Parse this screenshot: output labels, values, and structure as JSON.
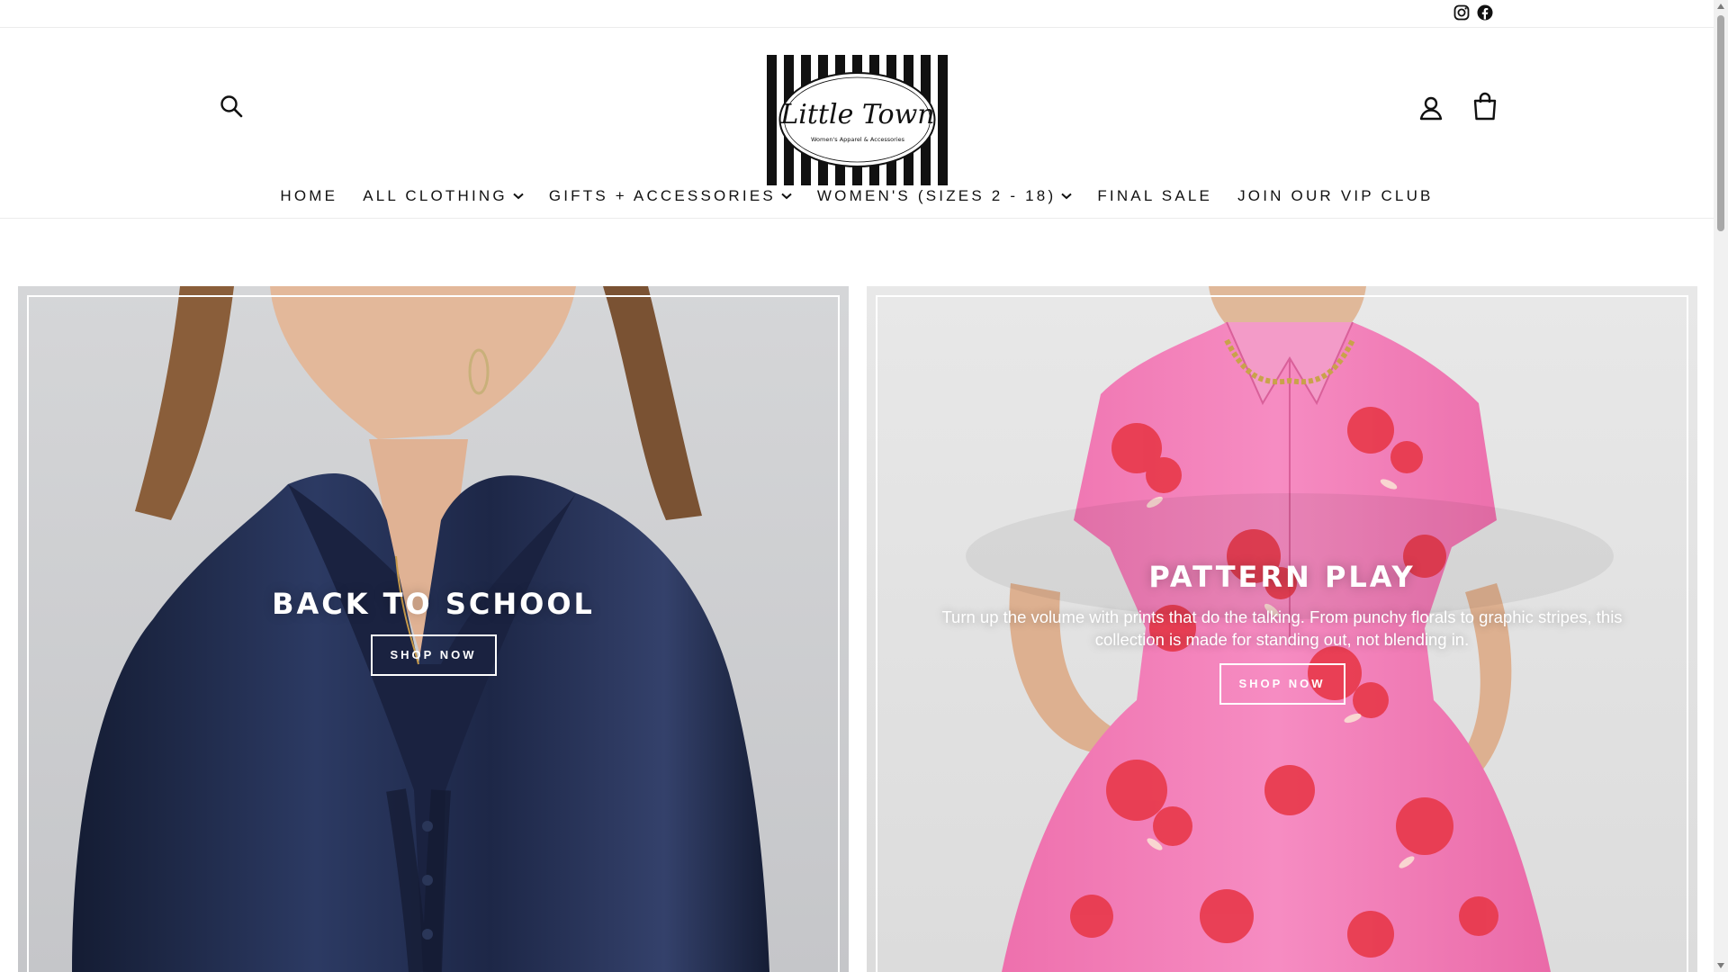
{
  "topbar": {
    "social_icons": [
      "instagram-icon",
      "facebook-icon"
    ]
  },
  "header": {
    "logo_text": "Little Town",
    "logo_tagline": "Women's Apparel & Accessories",
    "icons": {
      "search": "search-icon",
      "account": "user-icon",
      "cart": "shopping-bag-icon"
    },
    "search_label": "Search",
    "account_label": "Log in",
    "cart_label": "Cart"
  },
  "nav": {
    "items": [
      {
        "label": "HOME",
        "dropdown": false
      },
      {
        "label": "ALL CLOTHING",
        "dropdown": true
      },
      {
        "label": "GIFTS + ACCESSORIES",
        "dropdown": true
      },
      {
        "label": "WOMEN'S (SIZES 2 - 18)",
        "dropdown": true
      },
      {
        "label": "FINAL SALE",
        "dropdown": false
      },
      {
        "label": "JOIN OUR VIP CLUB",
        "dropdown": false
      }
    ]
  },
  "panels": [
    {
      "title": "BACK TO SCHOOL",
      "description": "",
      "button": "SHOP NOW"
    },
    {
      "title": "PATTERN PLAY",
      "description": "Turn up the volume with prints that do the talking. From punchy florals to graphic stripes, this collection is made for standing out, not blending in.",
      "button": "SHOP NOW"
    }
  ],
  "colors": {
    "text": "#111111",
    "border": "#ececec",
    "blouse_navy": "#1c2642",
    "dress_pink": "#f07fb8",
    "floral_red": "#e8384a"
  }
}
